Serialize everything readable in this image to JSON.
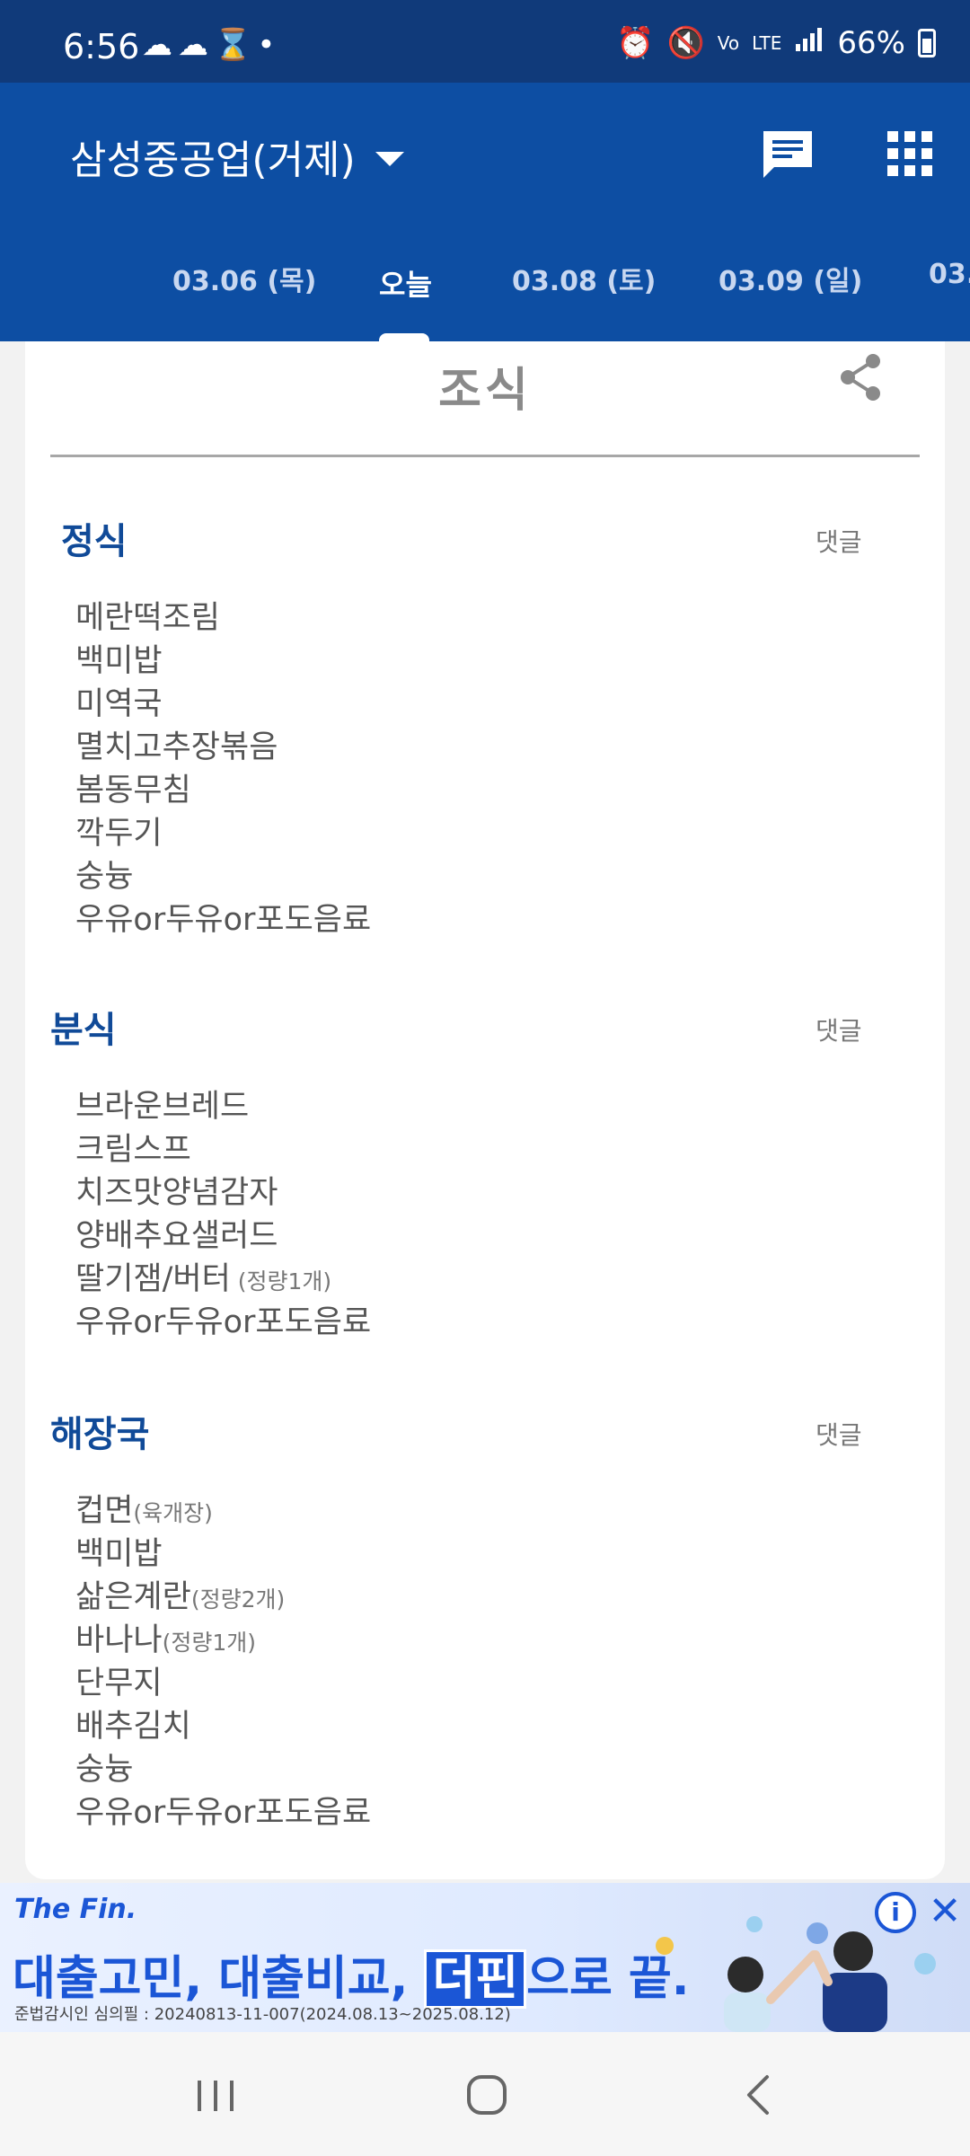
{
  "status_bar": {
    "time": "6:56",
    "left_icons": [
      "cloud-icon",
      "weather-icon",
      "hourglass-icon",
      "dot-icon"
    ],
    "right_icons": [
      "alarm-icon",
      "mute-icon",
      "volte-icon",
      "lte-icon",
      "signal-icon"
    ],
    "network": "LTE",
    "battery": "66%"
  },
  "app_bar": {
    "location": "삼성중공업(거제)",
    "icons": [
      "chat-icon",
      "apps-grid-icon"
    ],
    "tabs": [
      {
        "label": "03.06 (목)"
      },
      {
        "label": "오늘"
      },
      {
        "label": "03.08 (토)"
      },
      {
        "label": "03.09 (일)"
      },
      {
        "label": "03."
      }
    ],
    "active_tab_index": 1
  },
  "card": {
    "meal_title": "조식",
    "sections": [
      {
        "title": "정식",
        "comment_label": "댓글",
        "items": [
          {
            "name": "메란떡조림",
            "note": ""
          },
          {
            "name": "백미밥",
            "note": ""
          },
          {
            "name": "미역국",
            "note": ""
          },
          {
            "name": "멸치고추장볶음",
            "note": ""
          },
          {
            "name": "봄동무침",
            "note": ""
          },
          {
            "name": "깍두기",
            "note": ""
          },
          {
            "name": "숭늉",
            "note": ""
          },
          {
            "name": "우유or두유or포도음료",
            "note": ""
          }
        ]
      },
      {
        "title": "분식",
        "comment_label": "댓글",
        "items": [
          {
            "name": "브라운브레드",
            "note": ""
          },
          {
            "name": "크림스프",
            "note": ""
          },
          {
            "name": "치즈맛양념감자",
            "note": ""
          },
          {
            "name": "양배추요샐러드",
            "note": ""
          },
          {
            "name": "딸기잼/버터",
            "note": " (정량1개)"
          },
          {
            "name": "우유or두유or포도음료",
            "note": ""
          }
        ]
      },
      {
        "title": "해장국",
        "comment_label": "댓글",
        "items": [
          {
            "name": "컵면",
            "note": "(육개장)"
          },
          {
            "name": "백미밥",
            "note": ""
          },
          {
            "name": "삶은계란",
            "note": "(정량2개)"
          },
          {
            "name": "바나나",
            "note": "(정량1개)"
          },
          {
            "name": "단무지",
            "note": ""
          },
          {
            "name": "배추김치",
            "note": ""
          },
          {
            "name": "숭늉",
            "note": ""
          },
          {
            "name": "우유or두유or포도음료",
            "note": ""
          }
        ]
      }
    ]
  },
  "ad": {
    "brand": "The Fin.",
    "headline_part1": "대출고민, 대출비교, ",
    "headline_box": "더핀",
    "headline_part2": "으로 끝.",
    "legal": "준법감시인 심의필 : 20240813-11-007(2024.08.13~2025.08.12)",
    "info_icon": "info-icon",
    "close_icon": "close-icon"
  },
  "nav_bar": {
    "icons": [
      "recent-apps-icon",
      "home-icon",
      "back-icon"
    ]
  },
  "colors": {
    "status_bar": "#103a7a",
    "app_bar": "#0d4ea3",
    "section_title": "#104a98",
    "ad_accent": "#1b56d6"
  }
}
